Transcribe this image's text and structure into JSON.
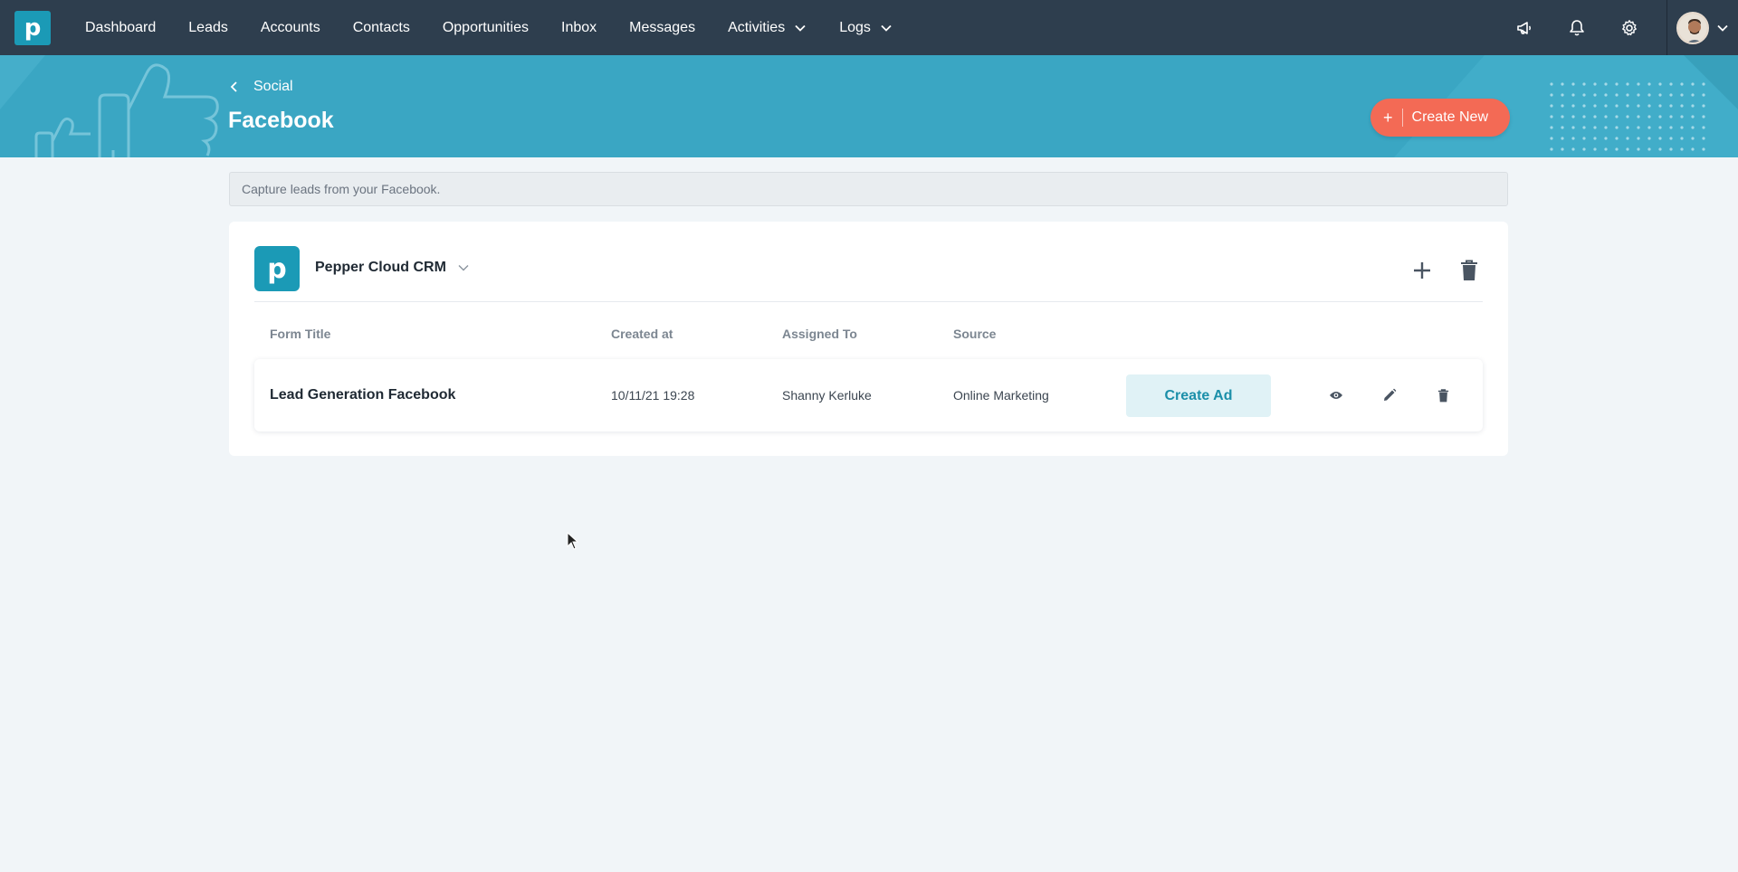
{
  "nav": {
    "logo": "p",
    "items": [
      {
        "label": "Dashboard"
      },
      {
        "label": "Leads"
      },
      {
        "label": "Accounts"
      },
      {
        "label": "Contacts"
      },
      {
        "label": "Opportunities"
      },
      {
        "label": "Inbox"
      },
      {
        "label": "Messages"
      },
      {
        "label": "Activities"
      },
      {
        "label": "Logs"
      }
    ],
    "icons": [
      "megaphone-icon",
      "bell-icon",
      "gear-icon"
    ]
  },
  "header": {
    "breadcrumb": "Social",
    "title": "Facebook",
    "create_new_label": "Create New"
  },
  "info_text": "Capture leads from your Facebook.",
  "page": {
    "name": "Pepper Cloud CRM",
    "logo": "p"
  },
  "table": {
    "columns": [
      "Form Title",
      "Created at",
      "Assigned To",
      "Source"
    ],
    "rows": [
      {
        "form_title": "Lead Generation Facebook",
        "created_at": "10/11/21 19:28",
        "assigned_to": "Shanny Kerluke",
        "source": "Online Marketing",
        "action_label": "Create Ad"
      }
    ]
  },
  "colors": {
    "topnav": "#2e3e4e",
    "banner": "#3aa6c3",
    "brand": "#1b9ab6",
    "accent_button": "#f36a55"
  }
}
